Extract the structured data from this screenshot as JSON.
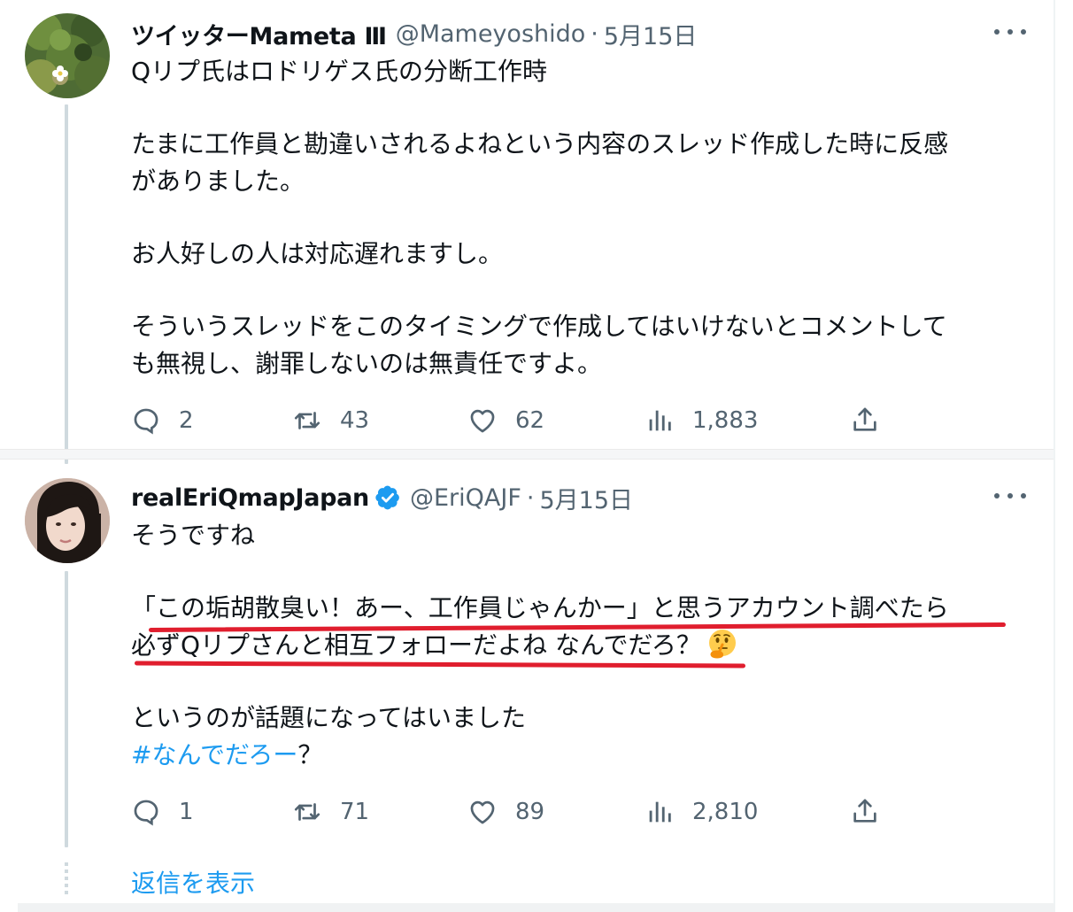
{
  "tweets": [
    {
      "display_name": "ツイッターMameta Ⅲ",
      "handle": "@Mameyoshido",
      "separator": "·",
      "date": "5月15日",
      "verified": false,
      "paragraphs": [
        [
          "Qリプ氏はロドリゲス氏の分断工作時"
        ],
        [
          "たまに工作員と勘違いされるよねという内容のスレッド作成した時に反感",
          "がありました。"
        ],
        [
          "お人好しの人は対応遅れますし。"
        ],
        [
          "そういうスレッドをこのタイミングで作成してはいけないとコメントして",
          "も無視し、謝罪しないのは無責任ですよ。"
        ]
      ],
      "actions": {
        "reply_count": "2",
        "retweet_count": "43",
        "like_count": "62",
        "view_count": "1,883"
      }
    },
    {
      "display_name": "realEriQmapJapan",
      "handle": "@EriQAJF",
      "separator": "·",
      "date": "5月15日",
      "verified": true,
      "paragraphs": [
        [
          "そうですね"
        ],
        [
          "「この垢胡散臭い！あー、工作員じゃんかー」と思うアカウント調べたら",
          "必ずQリプさんと相互フォローだよね  なんでだろ？"
        ],
        [
          "というのが話題になってはいました"
        ]
      ],
      "hashtag": "#なんでだろー",
      "hashtag_suffix": "？",
      "emoji": "thinking-face-emoji",
      "actions": {
        "reply_count": "1",
        "retweet_count": "71",
        "like_count": "89",
        "view_count": "2,810"
      }
    }
  ],
  "show_replies_label": "返信を表示",
  "colors": {
    "link": "#1d9bf0",
    "secondary_text": "#536471",
    "thread_line": "#cfd9de",
    "verified_badge": "#1d9bf0",
    "annotation_underline": "#e01e2e"
  }
}
